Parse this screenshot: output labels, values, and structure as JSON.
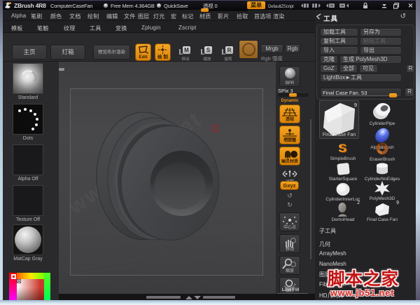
{
  "title_bar": {
    "app": "ZBrush 4R8",
    "document": "ComputerCaseFan",
    "free_mem": "Free Mem 4.364GB",
    "quicksave": "QuickSave",
    "perspective": "透视 0",
    "menu_button": "菜单",
    "zscript_name": "DefaultZScript",
    "close": "✕"
  },
  "menu": {
    "row1": [
      "Alpha",
      "笔刷",
      "颜色",
      "文档",
      "绘制",
      "编辑",
      "文件",
      "图层",
      "灯光",
      "宏",
      "标记",
      "材质",
      "影片",
      "拾取",
      "首选项",
      "渲染"
    ],
    "row2": [
      "模板",
      "笔触",
      "纹理",
      "工具",
      "变换",
      "Zplugin",
      "Zscript"
    ]
  },
  "toolbar": {
    "home": "主页",
    "lightbox": "灯箱",
    "preview_boolean": "预览布尔渲染",
    "edit_label": "Edit",
    "draw_label": "绘 制",
    "move_letter": "M",
    "scale_letter": "S",
    "rotate_letter": "R",
    "move_label": "移动",
    "scale_label": "缩放",
    "rotate_label": "旋转",
    "mrgb": "Mrgb",
    "rgb": "Rgb",
    "rgb_intensity": "Rgb 强度"
  },
  "left_shelf": {
    "items": [
      {
        "label": "Standard"
      },
      {
        "label": "Dots"
      },
      {
        "label": "Alpha Off"
      },
      {
        "label": "Texture Off"
      },
      {
        "label": "MatCap Gray"
      }
    ]
  },
  "canvas": {
    "watermark_diagonal": "www.jb51.net"
  },
  "right_shelf": {
    "bpr": "BPR",
    "spix": "SPix 3",
    "dynamic": "Dynamic",
    "persp": "透视",
    "floor": "地面栅",
    "ghost": "幽灵材质",
    "symmetry": "对称",
    "gxyz": "Gxyz",
    "center_point": "中心点",
    "scroll": "移动",
    "zoom": "缩放",
    "rotate": "旋转",
    "line_fill": "Line Fill"
  },
  "tool_panel": {
    "header": "工具",
    "reset_icon": "↺",
    "buttons": {
      "load": "加载工具",
      "save_as": "另存为",
      "copy": "复制工具",
      "paste": "粘贴工具",
      "import": "导入",
      "export": "导出",
      "clone": "克隆",
      "make_polymesh": "生成 PolyMesh3D",
      "goz": "GoZ",
      "all": "全部",
      "visible": "可见",
      "r_small": "R",
      "lightbox_tool": "LightBox►工具",
      "r_slider": "R"
    },
    "slider_label": "Final Case Fan. 53",
    "inventory": {
      "active": {
        "label": "Final Case Fan",
        "badge": "9"
      },
      "items": [
        {
          "label": "CylinderPipe"
        },
        {
          "label": "AlphaBrush"
        },
        {
          "label": "SimpleBrush"
        },
        {
          "label": "EraserBrush"
        },
        {
          "label": "StarterSquare"
        },
        {
          "label": "CylinderNoEdges"
        },
        {
          "label": "CylinderInnerLoc"
        },
        {
          "label": "PolyMesh3D"
        },
        {
          "label": "DemoHead",
          "badge": "2"
        },
        {
          "label": "Final Case Fan",
          "badge": "9"
        }
      ]
    },
    "sections": [
      "子工具",
      "几何",
      "ArrayMesh",
      "NanoMesh",
      "图层",
      "FiberMesh",
      "HD几何体"
    ]
  },
  "watermark": {
    "title": "脚本之家",
    "url": "www.jb51.net"
  },
  "colors": {
    "accent_orange": "#ED9310",
    "watermark_red": "#C31414",
    "frame_blue": "#BDD2E4"
  }
}
